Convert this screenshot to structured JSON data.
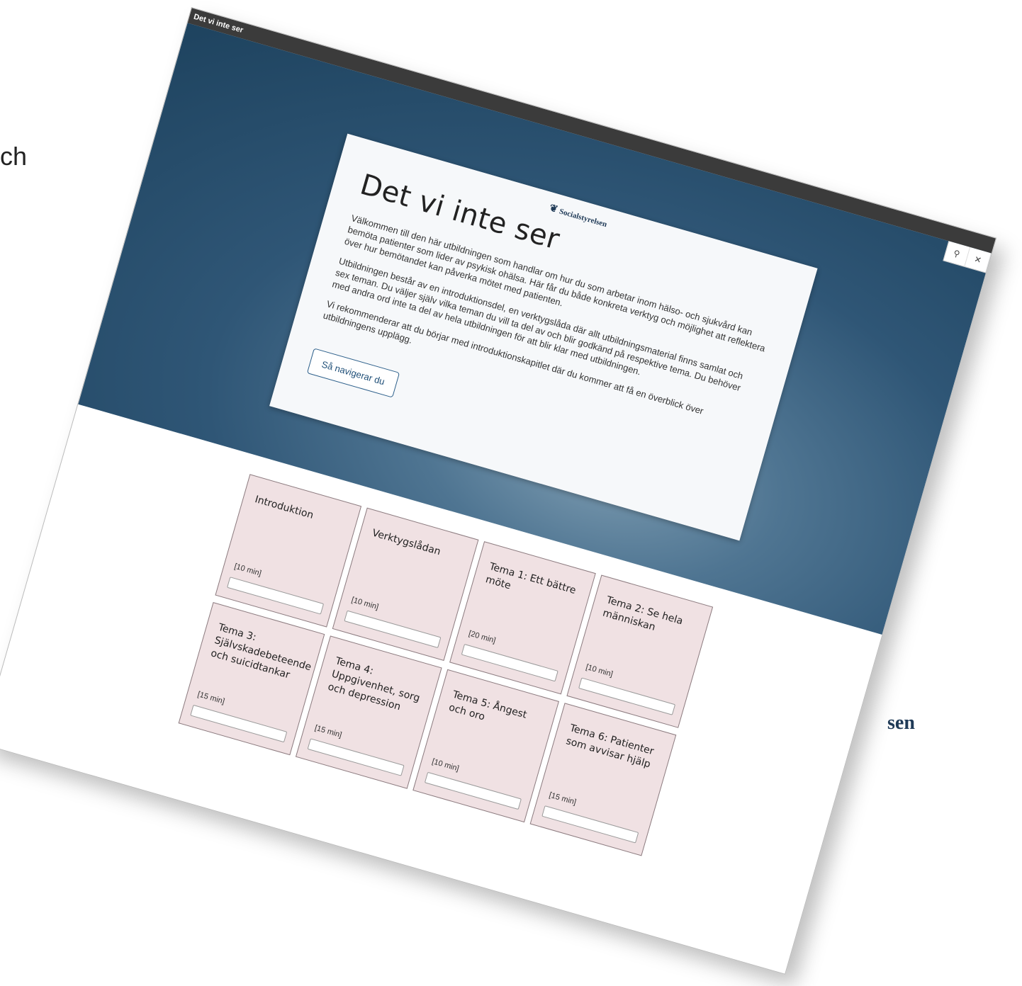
{
  "slide": {
    "left_fragment": "ch",
    "right_fragment": "sen"
  },
  "window": {
    "title": "Det vi inte ser",
    "search_icon": "search-icon",
    "close_icon": "close-icon"
  },
  "card": {
    "logo": "Socialstyrelsen",
    "title": "Det vi inte ser",
    "paragraphs": [
      "Välkommen till den här utbildningen som handlar om hur du som arbetar inom hälso- och sjukvård kan bemöta patienter som lider av psykisk ohälsa. Här får du både konkreta verktyg och möjlighet att reflektera över hur bemötandet kan påverka mötet med patienten.",
      "Utbildningen består av en introduktionsdel, en verktygslåda där allt utbildningsmaterial finns samlat och sex teman. Du väljer själv vilka teman du vill ta del av och blir godkänd på respektive tema. Du behöver med andra ord inte ta del av hela utbildningen för att blir klar med utbildningen.",
      "Vi rekommenderar att du börjar med introduktionskapitlet där du kommer att få en överblick över utbildningens upplägg."
    ],
    "nav_button": "Så navigerar du"
  },
  "tiles": [
    {
      "title": "Introduktion",
      "duration": "[10 min]",
      "progress": 0
    },
    {
      "title": "Verktygslådan",
      "duration": "[10 min]",
      "progress": 0
    },
    {
      "title": "Tema 1: Ett bättre möte",
      "duration": "[20 min]",
      "progress": 0
    },
    {
      "title": "Tema 2: Se hela människan",
      "duration": "[10 min]",
      "progress": 0
    },
    {
      "title": "Tema 3: Självskadebeteende och suicidtankar",
      "duration": "[15 min]",
      "progress": 0
    },
    {
      "title": "Tema 4: Uppgivenhet, sorg och depression",
      "duration": "[15 min]",
      "progress": 0
    },
    {
      "title": "Tema 5: Ångest och oro",
      "duration": "[10 min]",
      "progress": 0
    },
    {
      "title": "Tema 6: Patienter som avvisar hjälp",
      "duration": "[15 min]",
      "progress": 0
    }
  ]
}
